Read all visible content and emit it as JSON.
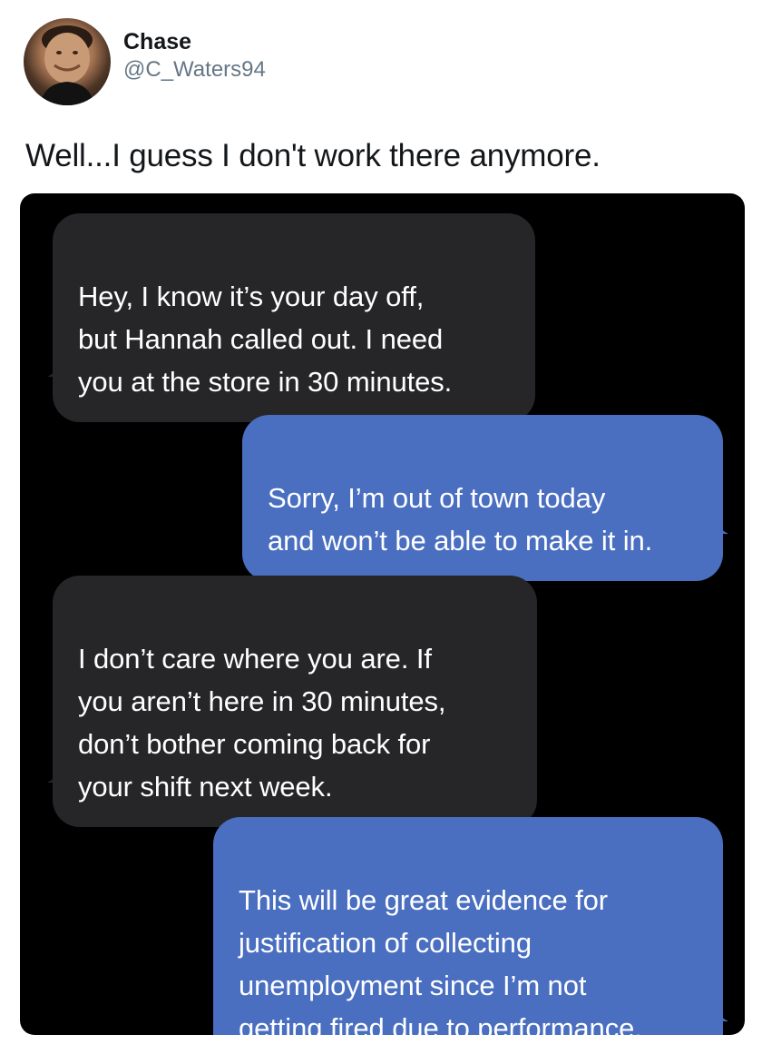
{
  "tweet": {
    "author": {
      "display_name": "Chase",
      "handle": "@C_Waters94"
    },
    "text": "Well...I guess I don't work there anymore."
  },
  "conversation": {
    "colors": {
      "background": "#000000",
      "incoming_bubble": "#262628",
      "outgoing_bubble": "#4a6fc0",
      "text": "#ffffff"
    },
    "messages": [
      {
        "direction": "incoming",
        "text": "Hey, I know it’s your day off,\nbut Hannah called out. I need\nyou at the store in 30 minutes."
      },
      {
        "direction": "outgoing",
        "text": "Sorry, I’m out of town today\nand won’t be able to make it in."
      },
      {
        "direction": "incoming",
        "text": "I don’t care where you are. If\nyou aren’t here in 30 minutes,\ndon’t bother coming back for\nyour shift next week."
      },
      {
        "direction": "outgoing",
        "text": "This will be great evidence for\njustification of collecting\nunemployment since I’m not\ngetting fired due to performance."
      }
    ]
  }
}
